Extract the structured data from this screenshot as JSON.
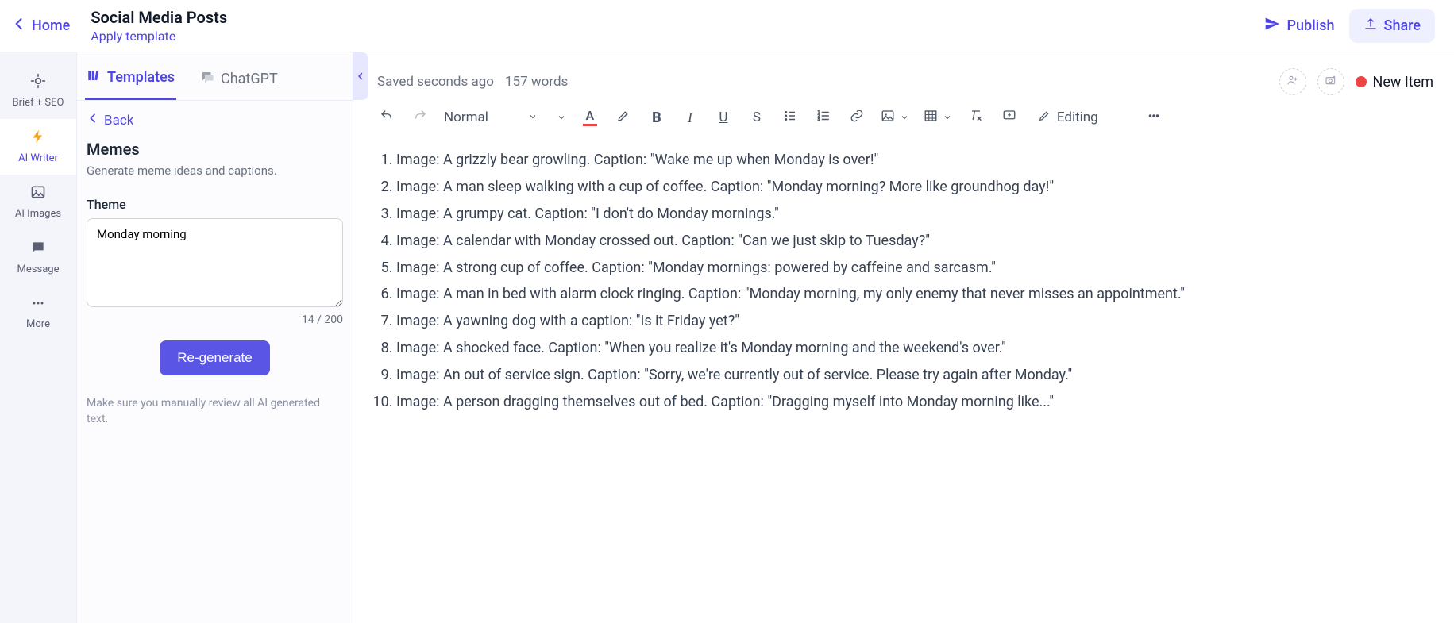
{
  "header": {
    "home": "Home",
    "title": "Social Media Posts",
    "apply_template": "Apply template",
    "publish": "Publish",
    "share": "Share"
  },
  "sidebar": {
    "items": [
      {
        "label": "Brief + SEO"
      },
      {
        "label": "AI Writer"
      },
      {
        "label": "AI Images"
      },
      {
        "label": "Message"
      },
      {
        "label": "More"
      }
    ]
  },
  "panel": {
    "tabs": {
      "templates": "Templates",
      "chatgpt": "ChatGPT"
    },
    "back": "Back",
    "section_title": "Memes",
    "section_desc": "Generate meme ideas and captions.",
    "theme_label": "Theme",
    "theme_value": "Monday morning",
    "char_count": "14 / 200",
    "regenerate": "Re-generate",
    "disclaimer": "Make sure you manually review all AI generated text."
  },
  "editor": {
    "saved": "Saved seconds ago",
    "words": "157 words",
    "new_item": "New Item",
    "paragraph_style": "Normal",
    "mode": "Editing"
  },
  "content": {
    "items": [
      "Image: A grizzly bear growling. Caption: \"Wake me up when Monday is over!\"",
      "Image: A man sleep walking with a cup of coffee. Caption: \"Monday morning? More like groundhog day!\"",
      "Image: A grumpy cat. Caption: \"I don't do Monday mornings.\"",
      "Image: A calendar with Monday crossed out. Caption: \"Can we just skip to Tuesday?\"",
      "Image: A strong cup of coffee. Caption: \"Monday mornings: powered by caffeine and sarcasm.\"",
      "Image: A man in bed with alarm clock ringing. Caption: \"Monday morning, my only enemy that never misses an appointment.\"",
      "Image: A yawning dog with a caption: \"Is it Friday yet?\"",
      "Image: A shocked face. Caption: \"When you realize it's Monday morning and the weekend's over.\"",
      "Image: An out of service sign. Caption: \"Sorry, we're currently out of service. Please try again after Monday.\"",
      "Image: A person dragging themselves out of bed. Caption: \"Dragging myself into Monday morning like...\""
    ]
  }
}
